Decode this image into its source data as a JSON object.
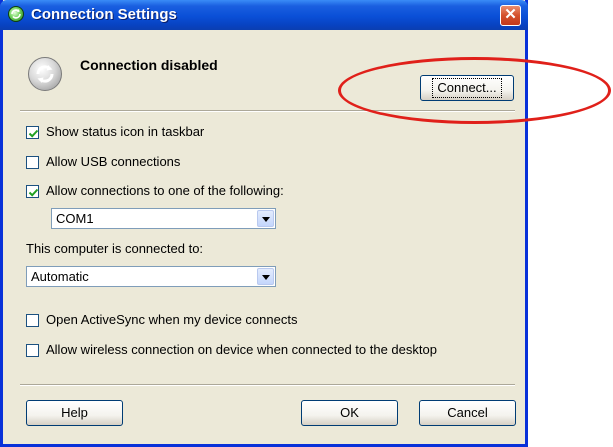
{
  "window": {
    "title": "Connection Settings",
    "close_glyph": "✕"
  },
  "status": {
    "text": "Connection disabled",
    "icon": "sync-disabled-icon"
  },
  "buttons": {
    "connect": "Connect...",
    "help": "Help",
    "ok": "OK",
    "cancel": "Cancel"
  },
  "options": {
    "show_status_icon": {
      "label": "Show status icon in taskbar",
      "checked": true
    },
    "allow_usb": {
      "label": "Allow USB connections",
      "checked": false
    },
    "allow_connections": {
      "label": "Allow connections to one of the following:",
      "checked": true
    },
    "open_activesync": {
      "label": "Open ActiveSync when my device connects",
      "checked": false
    },
    "allow_wireless": {
      "label": "Allow wireless connection on device when connected to the desktop",
      "checked": false
    }
  },
  "port_select": {
    "value": "COM1"
  },
  "connected_to": {
    "label": "This computer is connected to:",
    "value": "Automatic"
  },
  "annotation": {
    "color": "#e0201a"
  }
}
